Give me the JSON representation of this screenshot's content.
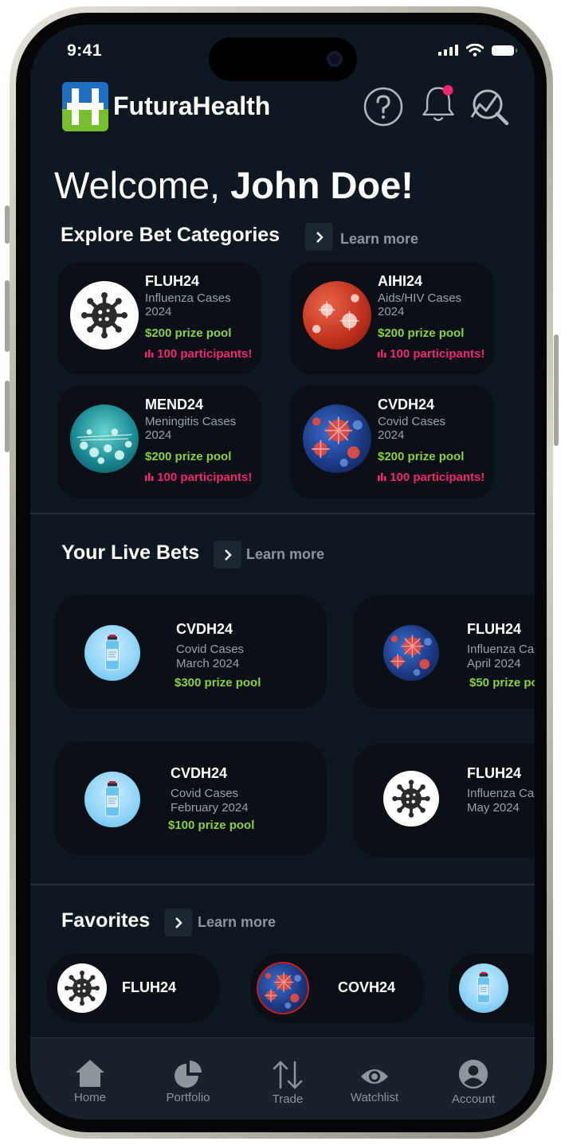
{
  "status_bar": {
    "time": "9:41"
  },
  "header": {
    "app_name": "FuturaHealth"
  },
  "welcome": {
    "greeting": "Welcome,",
    "user_name": "John Doe!"
  },
  "explore": {
    "title": "Explore Bet Categories",
    "learn_more": "Learn more",
    "cards": [
      {
        "code": "FLUH24",
        "line1": "Influenza Cases",
        "line2": "2024",
        "prize": "$200 prize pool",
        "participants": "100 participants!",
        "image": "virus-icon"
      },
      {
        "code": "AIHI24",
        "line1": "Aids/HIV Cases",
        "line2": "2024",
        "prize": "$200 prize pool",
        "participants": "100 participants!",
        "image": "red-virus-photo"
      },
      {
        "code": "MEND24",
        "line1": "Meningitis Cases",
        "line2": "2024",
        "prize": "$200 prize pool",
        "participants": "100 participants!",
        "image": "teal-bacteria-photo"
      },
      {
        "code": "CVDH24",
        "line1": "Covid Cases",
        "line2": "2024",
        "prize": "$200 prize pool",
        "participants": "100 participants!",
        "image": "blue-coronavirus-photo"
      }
    ]
  },
  "live_bets": {
    "title": "Your Live Bets",
    "learn_more": "Learn more",
    "cards": [
      {
        "code": "CVDH24",
        "line1": "Covid Cases",
        "line2": "March 2024",
        "prize": "$300 prize pool",
        "image": "vaccine-vial-photo"
      },
      {
        "code": "FLUH24",
        "line1": "Influenza Ca",
        "line2": "April 2024",
        "prize": "$50 prize po",
        "image": "blue-coronavirus-photo"
      },
      {
        "code": "CVDH24",
        "line1": "Covid Cases",
        "line2": "February 2024",
        "prize": "$100 prize pool",
        "image": "vaccine-vial-photo"
      },
      {
        "code": "FLUH24",
        "line1": "Influenza Ca",
        "line2": "May 2024",
        "prize": "",
        "image": "virus-icon"
      }
    ]
  },
  "favorites": {
    "title": "Favorites",
    "learn_more": "Learn more",
    "items": [
      {
        "code": "FLUH24",
        "image": "virus-icon"
      },
      {
        "code": "COVH24",
        "image": "blue-coronavirus-photo"
      },
      {
        "code": "",
        "image": "vaccine-vial-photo"
      }
    ]
  },
  "tabbar": {
    "items": [
      {
        "label": "Home",
        "icon": "home-icon"
      },
      {
        "label": "Portfolio",
        "icon": "pie-chart-icon"
      },
      {
        "label": "Trade",
        "icon": "up-down-arrows-icon"
      },
      {
        "label": "Watchlist",
        "icon": "eye-icon"
      },
      {
        "label": "Account",
        "icon": "user-circle-icon"
      }
    ]
  },
  "colors": {
    "background": "#0f1820",
    "card": "#0a1016",
    "prize": "#8ed13a",
    "participants": "#f02670",
    "notification_dot": "#f0266e"
  }
}
